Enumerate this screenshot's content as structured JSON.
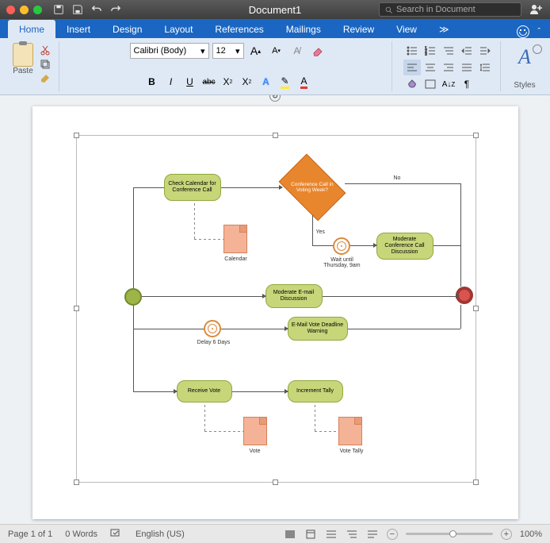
{
  "titlebar": {
    "title": "Document1",
    "search_placeholder": "Search in Document"
  },
  "tabs": {
    "items": [
      "Home",
      "Insert",
      "Design",
      "Layout",
      "References",
      "Mailings",
      "Review",
      "View"
    ],
    "active": 0
  },
  "ribbon": {
    "paste_label": "Paste",
    "font_name": "Calibri (Body)",
    "font_size": "12",
    "styles_label": "Styles",
    "bold": "B",
    "italic": "I",
    "underline": "U",
    "strike": "abc",
    "sub": "X",
    "sup": "X",
    "ainc": "A",
    "adec": "A"
  },
  "status": {
    "page": "Page 1 of 1",
    "words": "0 Words",
    "lang": "English (US)",
    "zoom": "100%"
  },
  "chart_data": {
    "type": "bpmn-flowchart",
    "nodes": [
      {
        "id": "start",
        "type": "start-event",
        "label": ""
      },
      {
        "id": "t1",
        "type": "task",
        "label": "Check Calendar for Conference Call"
      },
      {
        "id": "g1",
        "type": "gateway",
        "label": "Conference Call in Voting Week?"
      },
      {
        "id": "d1",
        "type": "data",
        "label": "Calendar"
      },
      {
        "id": "tm1",
        "type": "timer",
        "label": "Wait until Thursday, 9am"
      },
      {
        "id": "t2",
        "type": "task",
        "label": "Moderate Conference Call Discussion"
      },
      {
        "id": "t3",
        "type": "task",
        "label": "Moderate E-mail Discussion"
      },
      {
        "id": "tm2",
        "type": "timer",
        "label": "Delay 6 Days"
      },
      {
        "id": "t4",
        "type": "task",
        "label": "E-Mail Vote Deadline Warning"
      },
      {
        "id": "t5",
        "type": "task",
        "label": "Receive Vote"
      },
      {
        "id": "t6",
        "type": "task",
        "label": "Increment Tally"
      },
      {
        "id": "d2",
        "type": "data",
        "label": "Vote"
      },
      {
        "id": "d3",
        "type": "data",
        "label": "Vote Tally"
      },
      {
        "id": "end",
        "type": "end-event",
        "label": ""
      }
    ],
    "edges": [
      {
        "from": "start",
        "to": "t1"
      },
      {
        "from": "start",
        "to": "t3"
      },
      {
        "from": "start",
        "to": "tm2"
      },
      {
        "from": "start",
        "to": "t5"
      },
      {
        "from": "t1",
        "to": "g1"
      },
      {
        "from": "t1",
        "to": "d1",
        "type": "association"
      },
      {
        "from": "g1",
        "to": "tm1",
        "label": "Yes"
      },
      {
        "from": "g1",
        "to": "end",
        "label": "No"
      },
      {
        "from": "tm1",
        "to": "t2"
      },
      {
        "from": "t2",
        "to": "end"
      },
      {
        "from": "t3",
        "to": "end"
      },
      {
        "from": "tm2",
        "to": "t4"
      },
      {
        "from": "t4",
        "to": "end"
      },
      {
        "from": "t5",
        "to": "t6"
      },
      {
        "from": "t5",
        "to": "d2",
        "type": "association"
      },
      {
        "from": "t6",
        "to": "d3",
        "type": "association"
      },
      {
        "from": "d3",
        "to": "t6",
        "type": "association"
      }
    ],
    "edge_labels": {
      "yes": "Yes",
      "no": "No"
    }
  }
}
